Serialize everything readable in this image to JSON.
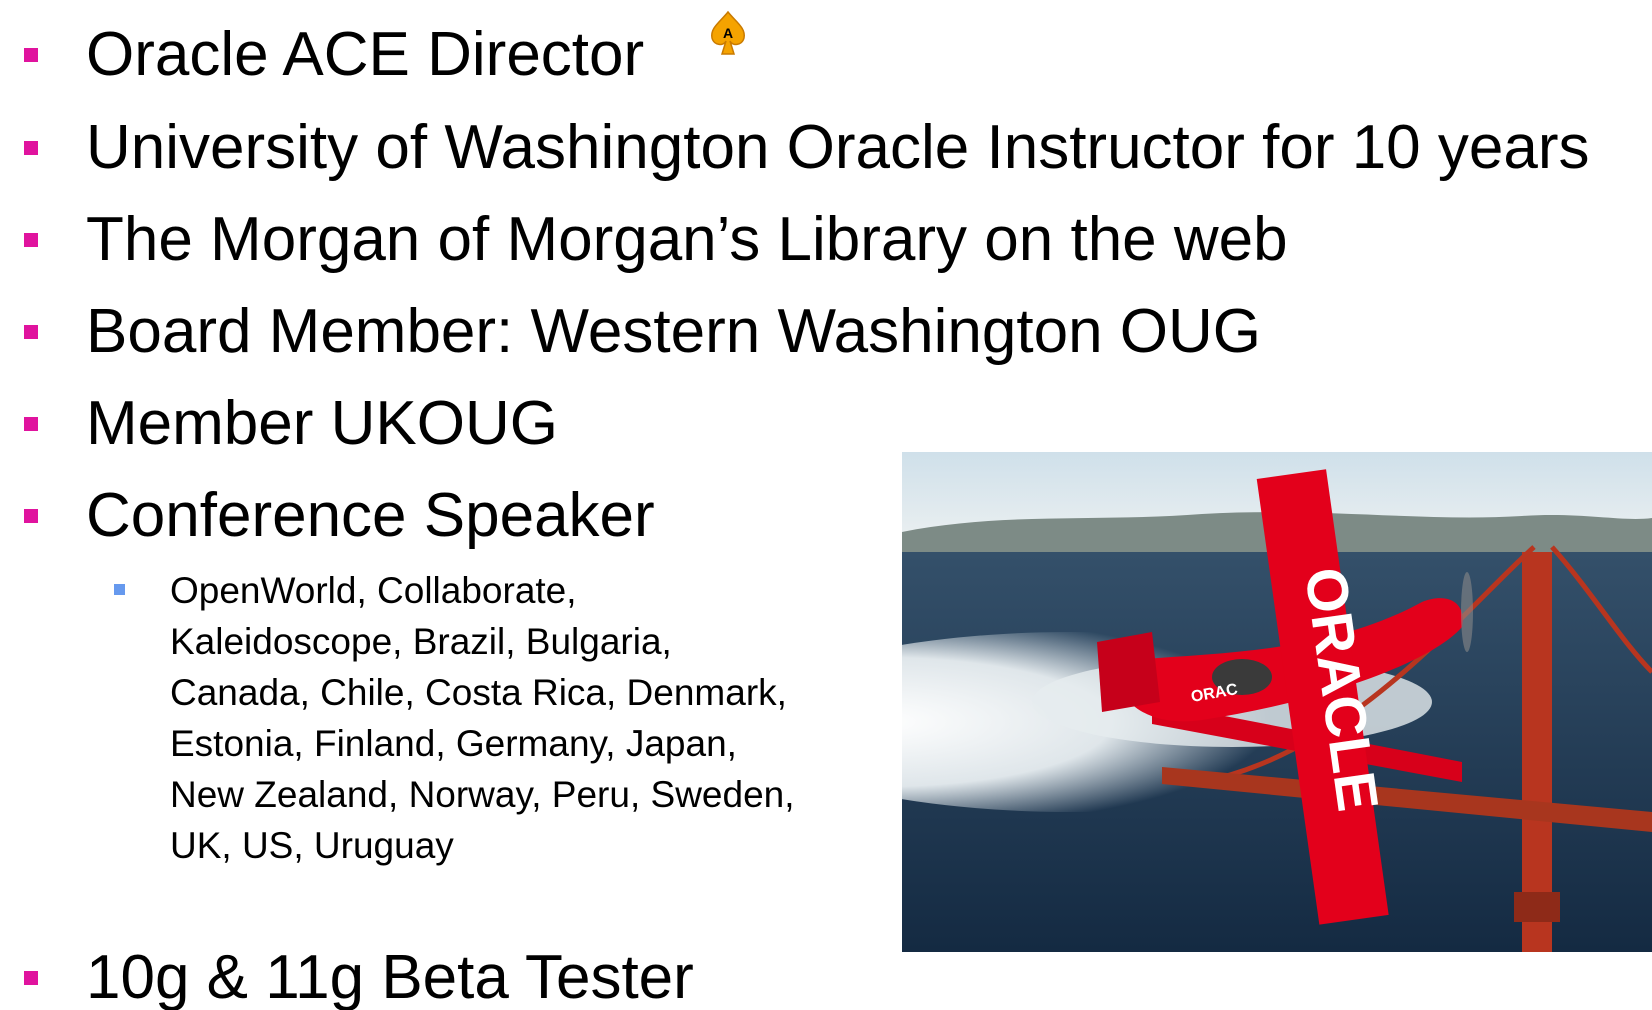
{
  "colors": {
    "bullet": "#e0139e",
    "sub_bullet": "#6699ee",
    "text": "#000000",
    "ace_badge": "#f5a300",
    "oracle_red": "#e3001b"
  },
  "badge": {
    "icon": "oracle-ace-spade-icon",
    "letter": "A"
  },
  "bullets": [
    {
      "text": "Oracle ACE Director"
    },
    {
      "text": "University of Washington Oracle Instructor for 10 years"
    },
    {
      "text": "The Morgan of Morgan’s Library on the web"
    },
    {
      "text": "Board Member: Western Washington OUG"
    },
    {
      "text": "Member UKOUG"
    },
    {
      "text": "Conference Speaker"
    },
    {
      "text": "10g & 11g Beta Tester"
    }
  ],
  "sub_bullets": [
    {
      "text": "OpenWorld, Collaborate, Kaleidoscope, Brazil, Bulgaria, Canada, Chile, Costa Rica, Denmark, Estonia, Finland, Germany, Japan, New Zealand, Norway, Peru, Sweden, UK, US, Uruguay"
    }
  ],
  "photo": {
    "description_icon": "oracle-biplane-golden-gate-photo",
    "wing_text": "ORACLE",
    "fuselage_text": "ORAC"
  }
}
